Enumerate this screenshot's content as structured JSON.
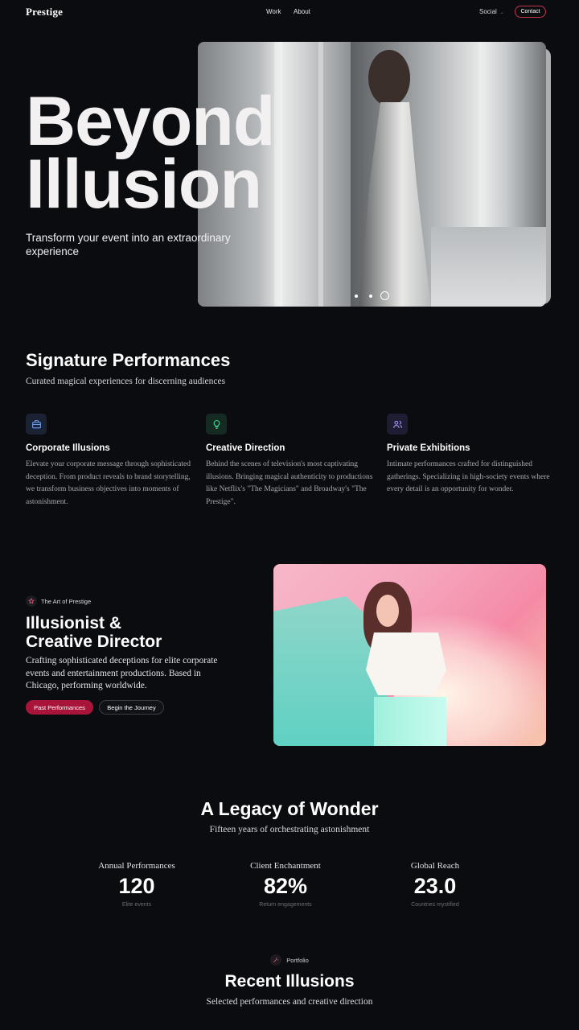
{
  "nav": {
    "logo": "Prestige",
    "links": [
      "Work",
      "About"
    ],
    "social": "Social",
    "contact": "Contact"
  },
  "hero": {
    "title_line1": "Beyond",
    "title_line2": "Illusion",
    "subtitle": "Transform your event into an extraordinary experience",
    "carousel": {
      "slide_count": 3,
      "active_index": 2
    }
  },
  "signature": {
    "title": "Signature Performances",
    "subtitle": "Curated magical experiences for discerning audiences",
    "cards": [
      {
        "icon": "briefcase-icon",
        "title": "Corporate Illusions",
        "text": "Elevate your corporate message through sophisticated deception. From product reveals to brand storytelling, we transform business objectives into moments of astonishment.",
        "accent": "#5b8ee6"
      },
      {
        "icon": "lightbulb-icon",
        "title": "Creative Direction",
        "text": "Behind the scenes of television's most captivating illusions. Bringing magical authenticity to productions like Netflix's \"The Magicians\" and Broadway's \"The Prestige\".",
        "accent": "#3fd28f"
      },
      {
        "icon": "users-icon",
        "title": "Private Exhibitions",
        "text": "Intimate performances crafted for distinguished gatherings. Specializing in high-society events where every detail is an opportunity for wonder.",
        "accent": "#9b8cf0"
      }
    ]
  },
  "about": {
    "badge": "The Art of Prestige",
    "title_line1": "Illusionist &",
    "title_line2": "Creative Director",
    "description": "Crafting sophisticated deceptions for elite corporate events and entertainment productions. Based in Chicago, performing worldwide.",
    "primary_button": "Past Performances",
    "secondary_button": "Begin the Journey"
  },
  "legacy": {
    "title": "A Legacy of Wonder",
    "subtitle": "Fifteen years of orchestrating astonishment",
    "stats": [
      {
        "label": "Annual Performances",
        "value": "120",
        "note": "Elite events"
      },
      {
        "label": "Client Enchantment",
        "value": "82%",
        "note": "Return engagements"
      },
      {
        "label": "Global Reach",
        "value": "23.0",
        "note": "Countries mystified"
      }
    ]
  },
  "portfolio": {
    "badge": "Portfolio",
    "title": "Recent Illusions",
    "subtitle": "Selected performances and creative direction"
  },
  "colors": {
    "accent": "#a8143a",
    "contact_border": "#c7334f",
    "background": "#0b0c0f"
  }
}
